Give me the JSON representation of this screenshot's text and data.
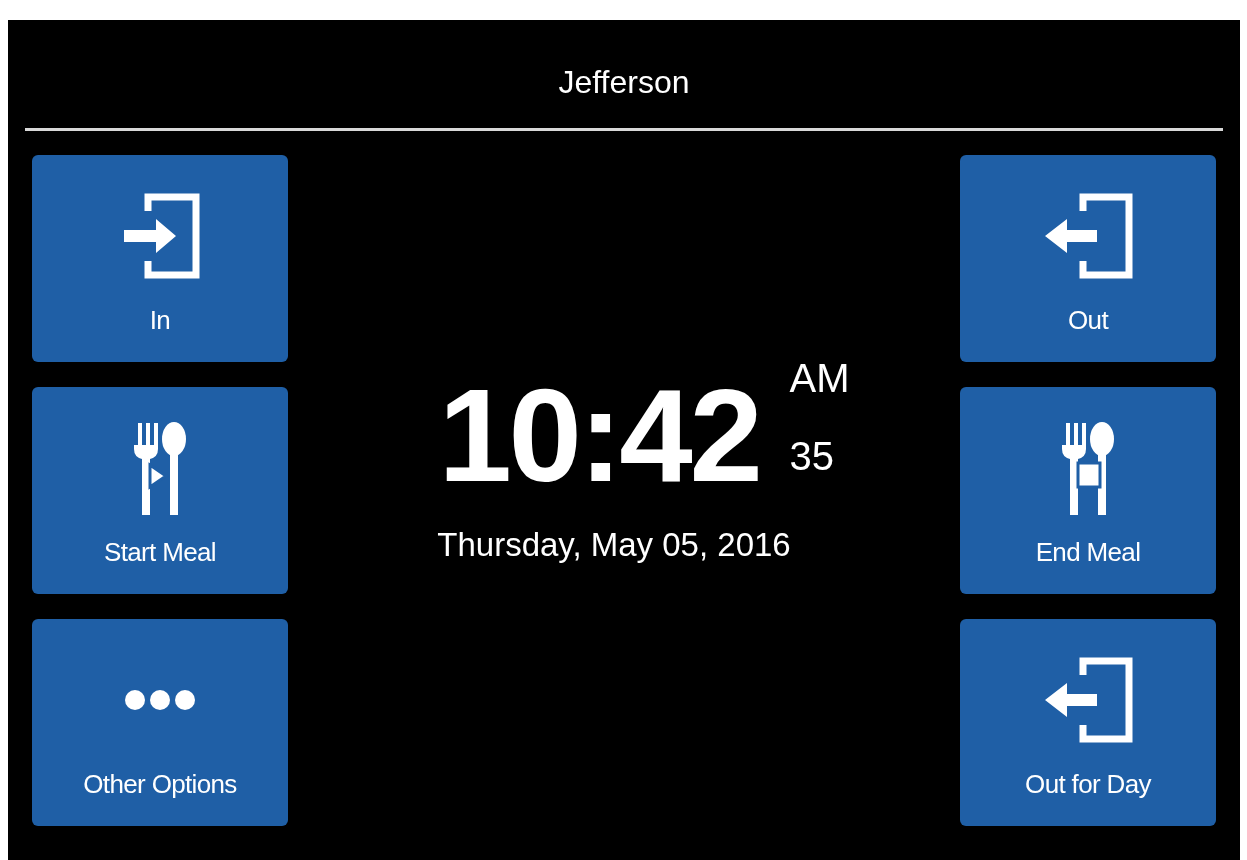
{
  "header": {
    "title": "Jefferson"
  },
  "left_buttons": [
    {
      "label": "In",
      "kind": "enter"
    },
    {
      "label": "Start Meal",
      "kind": "meal-start"
    },
    {
      "label": "Other Options",
      "kind": "more"
    }
  ],
  "clock": {
    "time": "10:42",
    "period": "AM",
    "seconds": "35",
    "date": "Thursday, May 05, 2016"
  },
  "right_buttons": [
    {
      "label": "Out",
      "kind": "exit"
    },
    {
      "label": "End Meal",
      "kind": "meal-end"
    },
    {
      "label": "Out for Day",
      "kind": "exit"
    }
  ]
}
